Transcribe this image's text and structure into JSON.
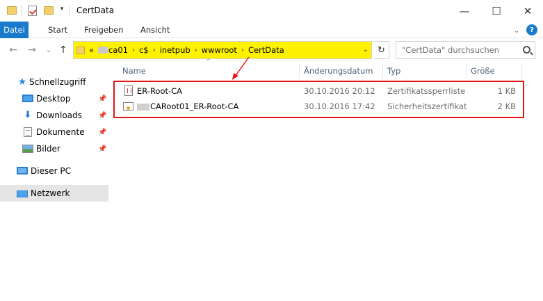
{
  "window": {
    "title": "CertData",
    "minimize_glyph": "—",
    "maximize_glyph": "☐",
    "close_glyph": "✕",
    "qa_dropdown_glyph": "▾"
  },
  "ribbon": {
    "tabs": [
      "Datei",
      "Start",
      "Freigeben",
      "Ansicht"
    ],
    "expand_glyph": "⌄",
    "help_glyph": "?"
  },
  "navigation": {
    "back_glyph": "←",
    "forward_glyph": "→",
    "history_glyph": "⌄",
    "up_glyph": "↑",
    "refresh_glyph": "↻"
  },
  "address": {
    "overflow": "«",
    "separator": "›",
    "crumbs": [
      "ca01",
      "c$",
      "inetpub",
      "wwwroot",
      "CertData"
    ],
    "dropdown_glyph": "⌄",
    "highlight_color": "#fff200"
  },
  "search": {
    "placeholder": "\"CertData\" durchsuchen"
  },
  "sidebar": {
    "quick_access": "Schnellzugriff",
    "pin_glyph": "📌",
    "items": [
      {
        "label": "Desktop",
        "icon": "desktop-icon",
        "pinned": true
      },
      {
        "label": "Downloads",
        "icon": "download-icon",
        "pinned": true
      },
      {
        "label": "Dokumente",
        "icon": "documents-icon",
        "pinned": true
      },
      {
        "label": "Bilder",
        "icon": "pictures-icon",
        "pinned": true
      }
    ],
    "this_pc": "Dieser PC",
    "network": "Netzwerk"
  },
  "file_list": {
    "sort_glyph": "^",
    "columns": {
      "name": "Name",
      "modified": "Änderungsdatum",
      "type": "Typ",
      "size": "Größe"
    },
    "files": [
      {
        "name": "ER-Root-CA",
        "modified": "30.10.2016 20:12",
        "type": "Zertifikatssperrliste",
        "size": "1 KB",
        "icon": "crl-file-icon"
      },
      {
        "name": "CARoot01_ER-Root-CA",
        "modified": "30.10.2016 17:42",
        "type": "Sicherheitszertifikat",
        "size": "2 KB",
        "icon": "certificate-file-icon"
      }
    ]
  },
  "annotation": {
    "box_color": "#e31414",
    "arrow_color": "#e31414"
  }
}
